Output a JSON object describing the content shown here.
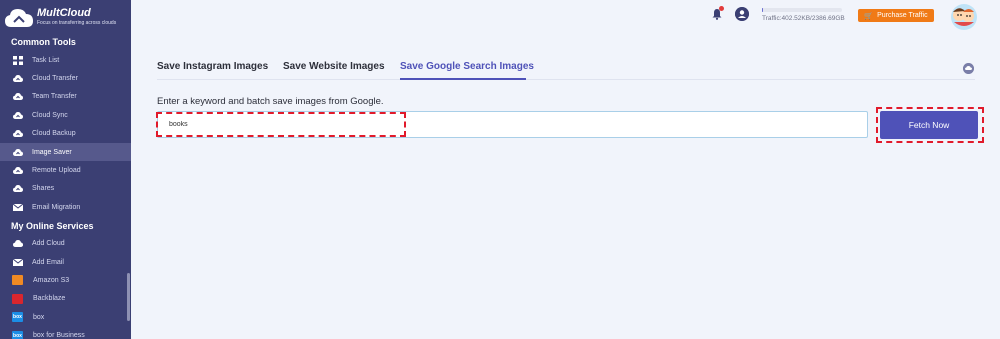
{
  "brand": {
    "name": "MultCloud",
    "slogan": "Focus on transferring across clouds"
  },
  "sidebar": {
    "section1": "Common Tools",
    "tools": [
      {
        "label": "Task List",
        "icon": "grid-icon"
      },
      {
        "label": "Cloud Transfer",
        "icon": "cloud-transfer-icon"
      },
      {
        "label": "Team Transfer",
        "icon": "team-transfer-icon"
      },
      {
        "label": "Cloud Sync",
        "icon": "cloud-sync-icon"
      },
      {
        "label": "Cloud Backup",
        "icon": "cloud-backup-icon"
      },
      {
        "label": "Image Saver",
        "icon": "image-saver-icon",
        "active": true
      },
      {
        "label": "Remote Upload",
        "icon": "remote-upload-icon"
      },
      {
        "label": "Shares",
        "icon": "shares-icon"
      },
      {
        "label": "Email Migration",
        "icon": "email-migration-icon"
      }
    ],
    "section2": "My Online Services",
    "services": [
      {
        "label": "Add Cloud",
        "icon": "add-cloud-icon"
      },
      {
        "label": "Add Email",
        "icon": "add-email-icon"
      },
      {
        "label": "Amazon S3",
        "icon": "amazon-s3-icon",
        "color": "#f08a24"
      },
      {
        "label": "Backblaze",
        "icon": "backblaze-icon",
        "color": "#d9262e"
      },
      {
        "label": "box",
        "icon": "box-icon",
        "color": "#1b8ee6"
      },
      {
        "label": "box for Business",
        "icon": "box-business-icon",
        "color": "#1b8ee6"
      }
    ]
  },
  "topbar": {
    "traffic": "Traffic:402.52KB/2386.69GB",
    "traffic_fraction": 0.0002,
    "purchase": "Purchase Traffic"
  },
  "tabs": [
    {
      "label": "Save Instagram Images"
    },
    {
      "label": "Save Website Images"
    },
    {
      "label": "Save Google Search Images",
      "active": true
    }
  ],
  "main": {
    "instruction": "Enter a keyword and batch save images from Google.",
    "search_value": "books",
    "fetch_label": "Fetch Now"
  },
  "colors": {
    "sidebar_bg": "#3b3f73",
    "accent": "#4f52b8",
    "purchase": "#f07a16",
    "highlight": "#e11a2b"
  }
}
